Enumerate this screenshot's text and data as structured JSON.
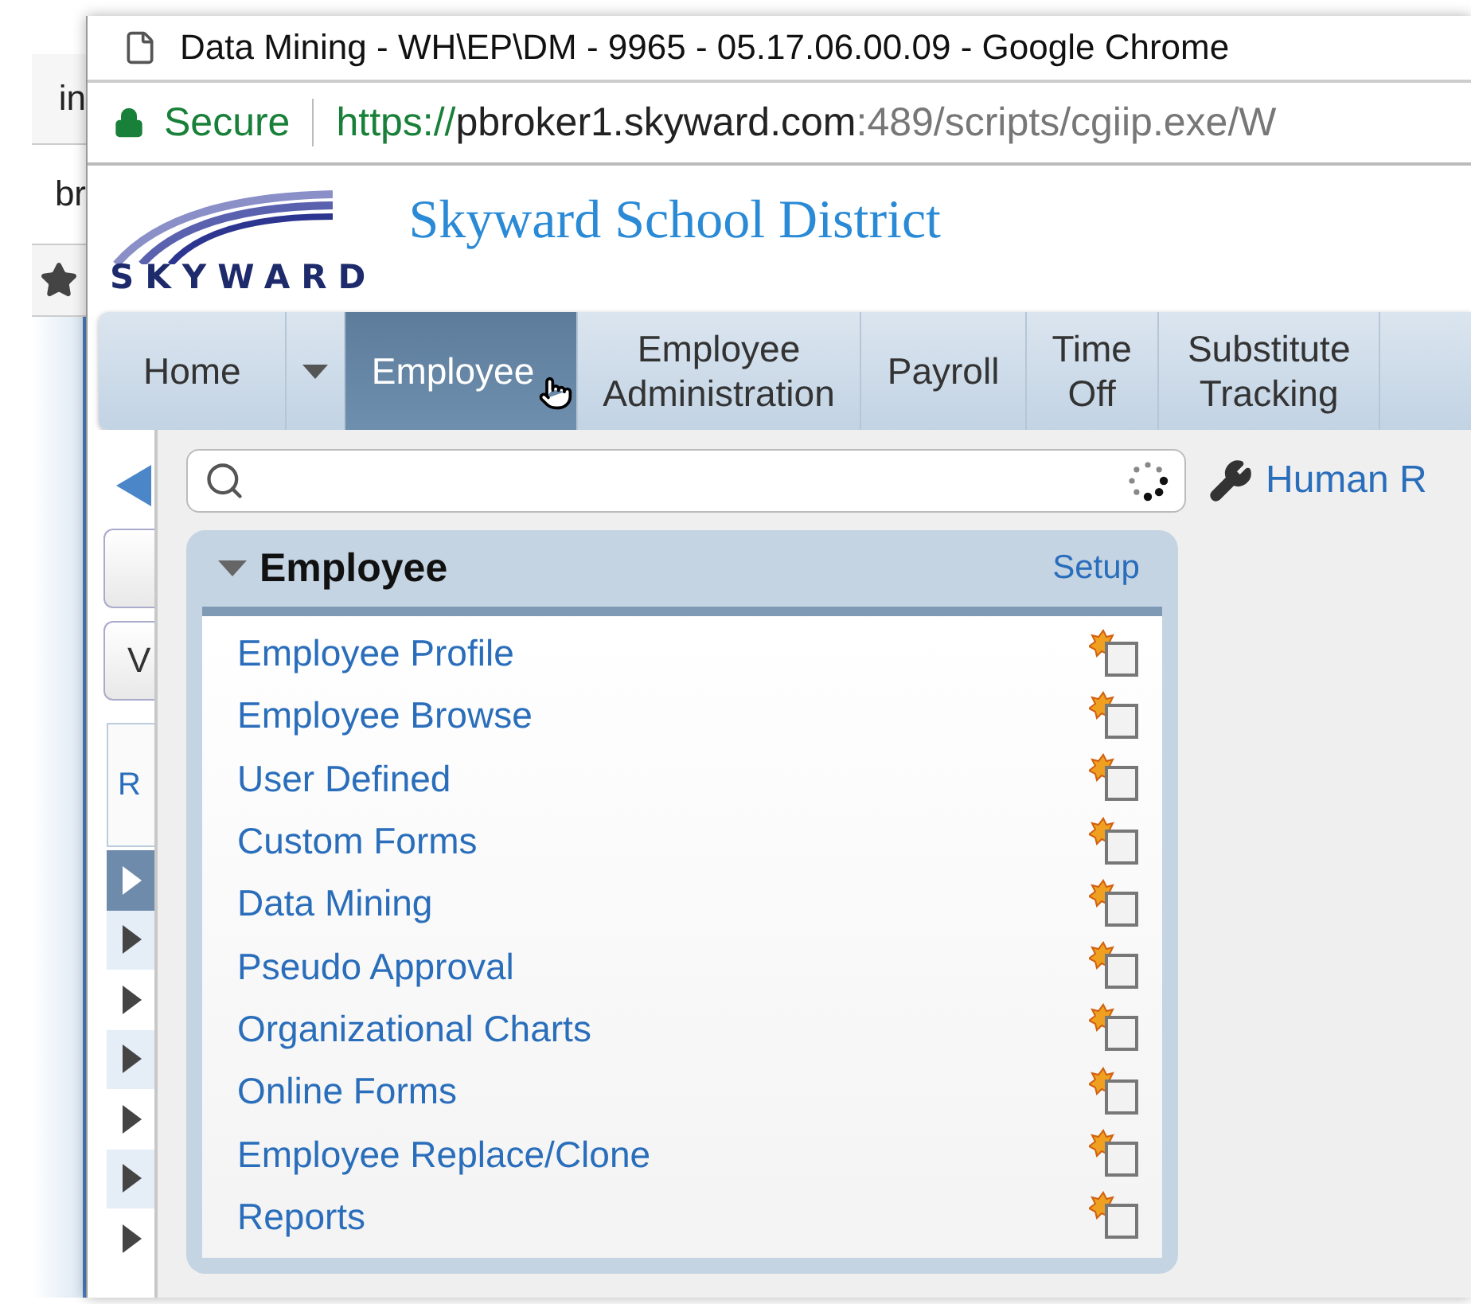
{
  "background_window": {
    "tabs": [
      {
        "label": "in"
      },
      {
        "label": "br"
      }
    ],
    "button": "V",
    "column_header": "R",
    "rows": [
      {
        "selected": true
      },
      {
        "selected": false
      },
      {
        "selected": false
      },
      {
        "selected": false
      },
      {
        "selected": false
      },
      {
        "selected": false
      },
      {
        "selected": false
      }
    ]
  },
  "window": {
    "title": "Data Mining - WH\\EP\\DM - 9965 - 05.17.06.00.09 - Google Chrome",
    "address_bar": {
      "security": "Secure",
      "url_scheme": "https://",
      "url_host": "pbroker1.skyward.com",
      "url_rest": ":489/scripts/cgiip.exe/W"
    }
  },
  "header": {
    "logo_text": "SKYWARD",
    "district": "Skyward School District"
  },
  "nav": [
    {
      "kind": "tab",
      "lines": [
        "Home"
      ],
      "selected": false
    },
    {
      "kind": "caret",
      "selected": false
    },
    {
      "kind": "tab",
      "lines": [
        "Employee"
      ],
      "selected": true
    },
    {
      "kind": "tab",
      "lines": [
        "Employee",
        "Administration"
      ],
      "selected": false
    },
    {
      "kind": "tab",
      "lines": [
        "Payroll"
      ],
      "selected": false
    },
    {
      "kind": "tab",
      "lines": [
        "Time",
        "Off"
      ],
      "selected": false
    },
    {
      "kind": "tab",
      "lines": [
        "Substitute",
        "Tracking"
      ],
      "selected": false
    }
  ],
  "menu": {
    "quick_link": "Human R",
    "panel": {
      "title": "Employee",
      "expanded": true,
      "setup": "Setup",
      "items": [
        "Employee Profile",
        "Employee Browse",
        "User Defined",
        "Custom Forms",
        "Data Mining",
        "Pseudo Approval",
        "Organizational Charts",
        "Online Forms",
        "Employee Replace/Clone",
        "Reports"
      ]
    }
  }
}
